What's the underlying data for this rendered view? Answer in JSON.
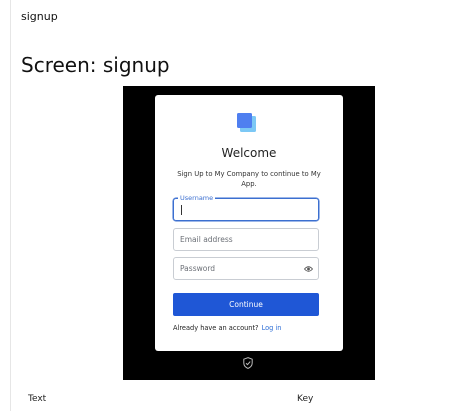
{
  "page": {
    "top_title": "signup",
    "screen_title": "Screen: signup"
  },
  "card": {
    "logo_icon": "stacked-cards-logo-icon",
    "heading": "Welcome",
    "subtitle": "Sign Up to My Company to continue to My App.",
    "username": {
      "label": "Username",
      "value": ""
    },
    "email": {
      "placeholder": "Email address",
      "value": ""
    },
    "password": {
      "placeholder": "Password",
      "value": "",
      "toggle_icon": "eye-icon"
    },
    "continue_label": "Continue",
    "login_prompt": "Already have an account?",
    "login_link": "Log in"
  },
  "footer_icon": "shield-badge-icon",
  "table": {
    "col1": "Text",
    "col2": "Key"
  },
  "colors": {
    "primary": "#1f57d6",
    "link": "#2f6fd6",
    "focus": "#3b6fd0",
    "stage": "#000000"
  }
}
